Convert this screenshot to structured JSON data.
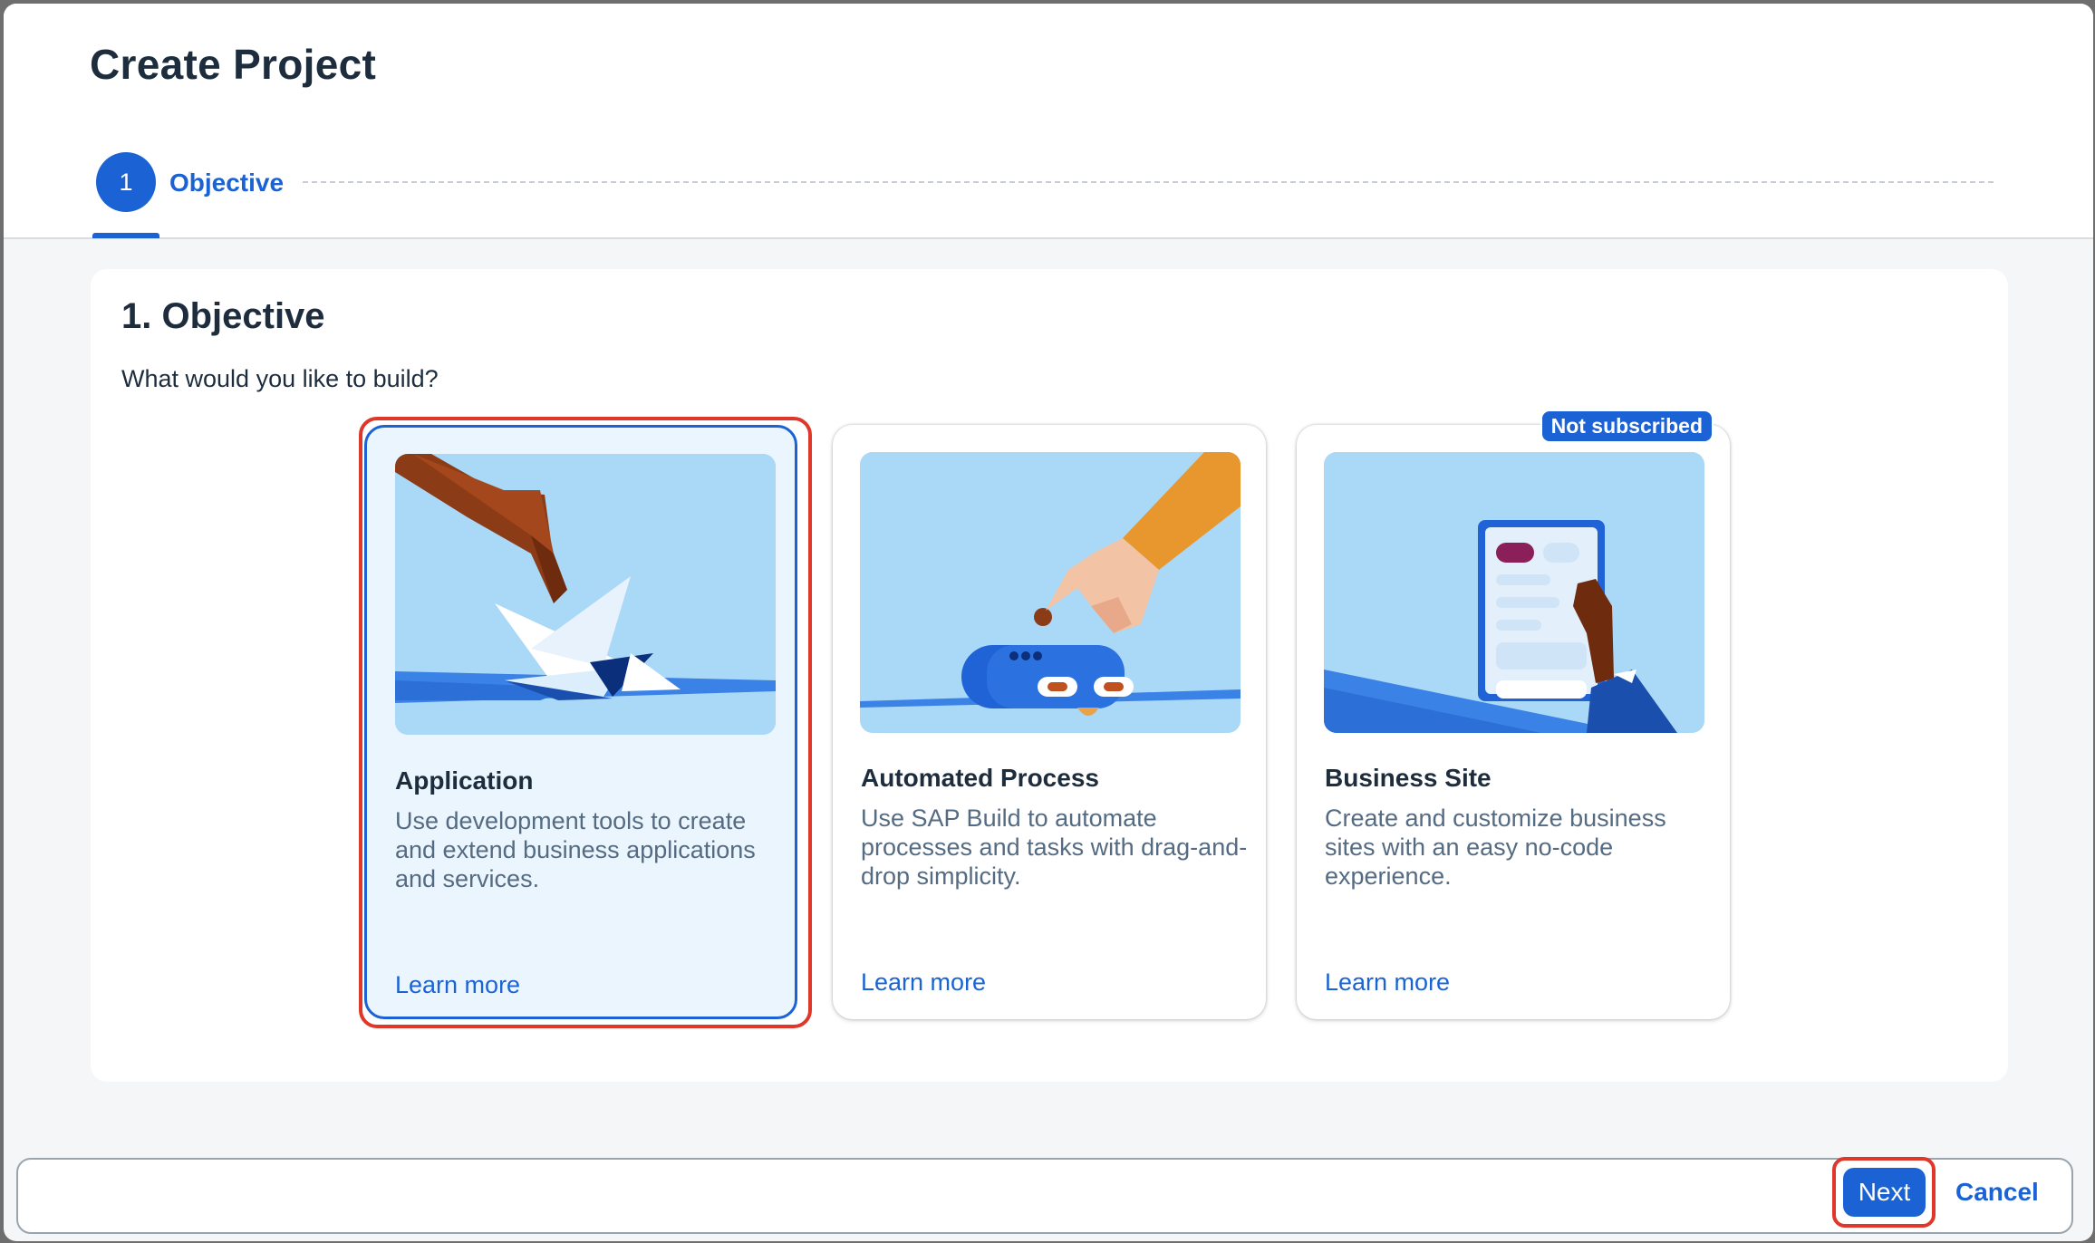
{
  "dialog": {
    "title": "Create Project"
  },
  "wizard": {
    "step_number": "1",
    "step_label": "Objective"
  },
  "panel": {
    "title": "1. Objective",
    "question": "What would you like to build?"
  },
  "cards": [
    {
      "title": "Application",
      "description": "Use development tools to create and extend business applications and services.",
      "link": "Learn more",
      "selected": true,
      "illustration": "hand-origami-crane"
    },
    {
      "title": "Automated Process",
      "description": "Use SAP Build to automate processes and tasks with drag-and-drop simplicity.",
      "link": "Learn more",
      "selected": false,
      "illustration": "hand-robot"
    },
    {
      "title": "Business Site",
      "description": "Create and customize business sites with an easy no-code experience.",
      "link": "Learn more",
      "selected": false,
      "badge": "Not subscribed",
      "illustration": "hand-tablet"
    }
  ],
  "footer": {
    "next_label": "Next",
    "cancel_label": "Cancel"
  },
  "colors": {
    "accent": "#1b63d4",
    "highlight_outline": "#e0372b",
    "illustration_bg": "#aad8f7"
  }
}
